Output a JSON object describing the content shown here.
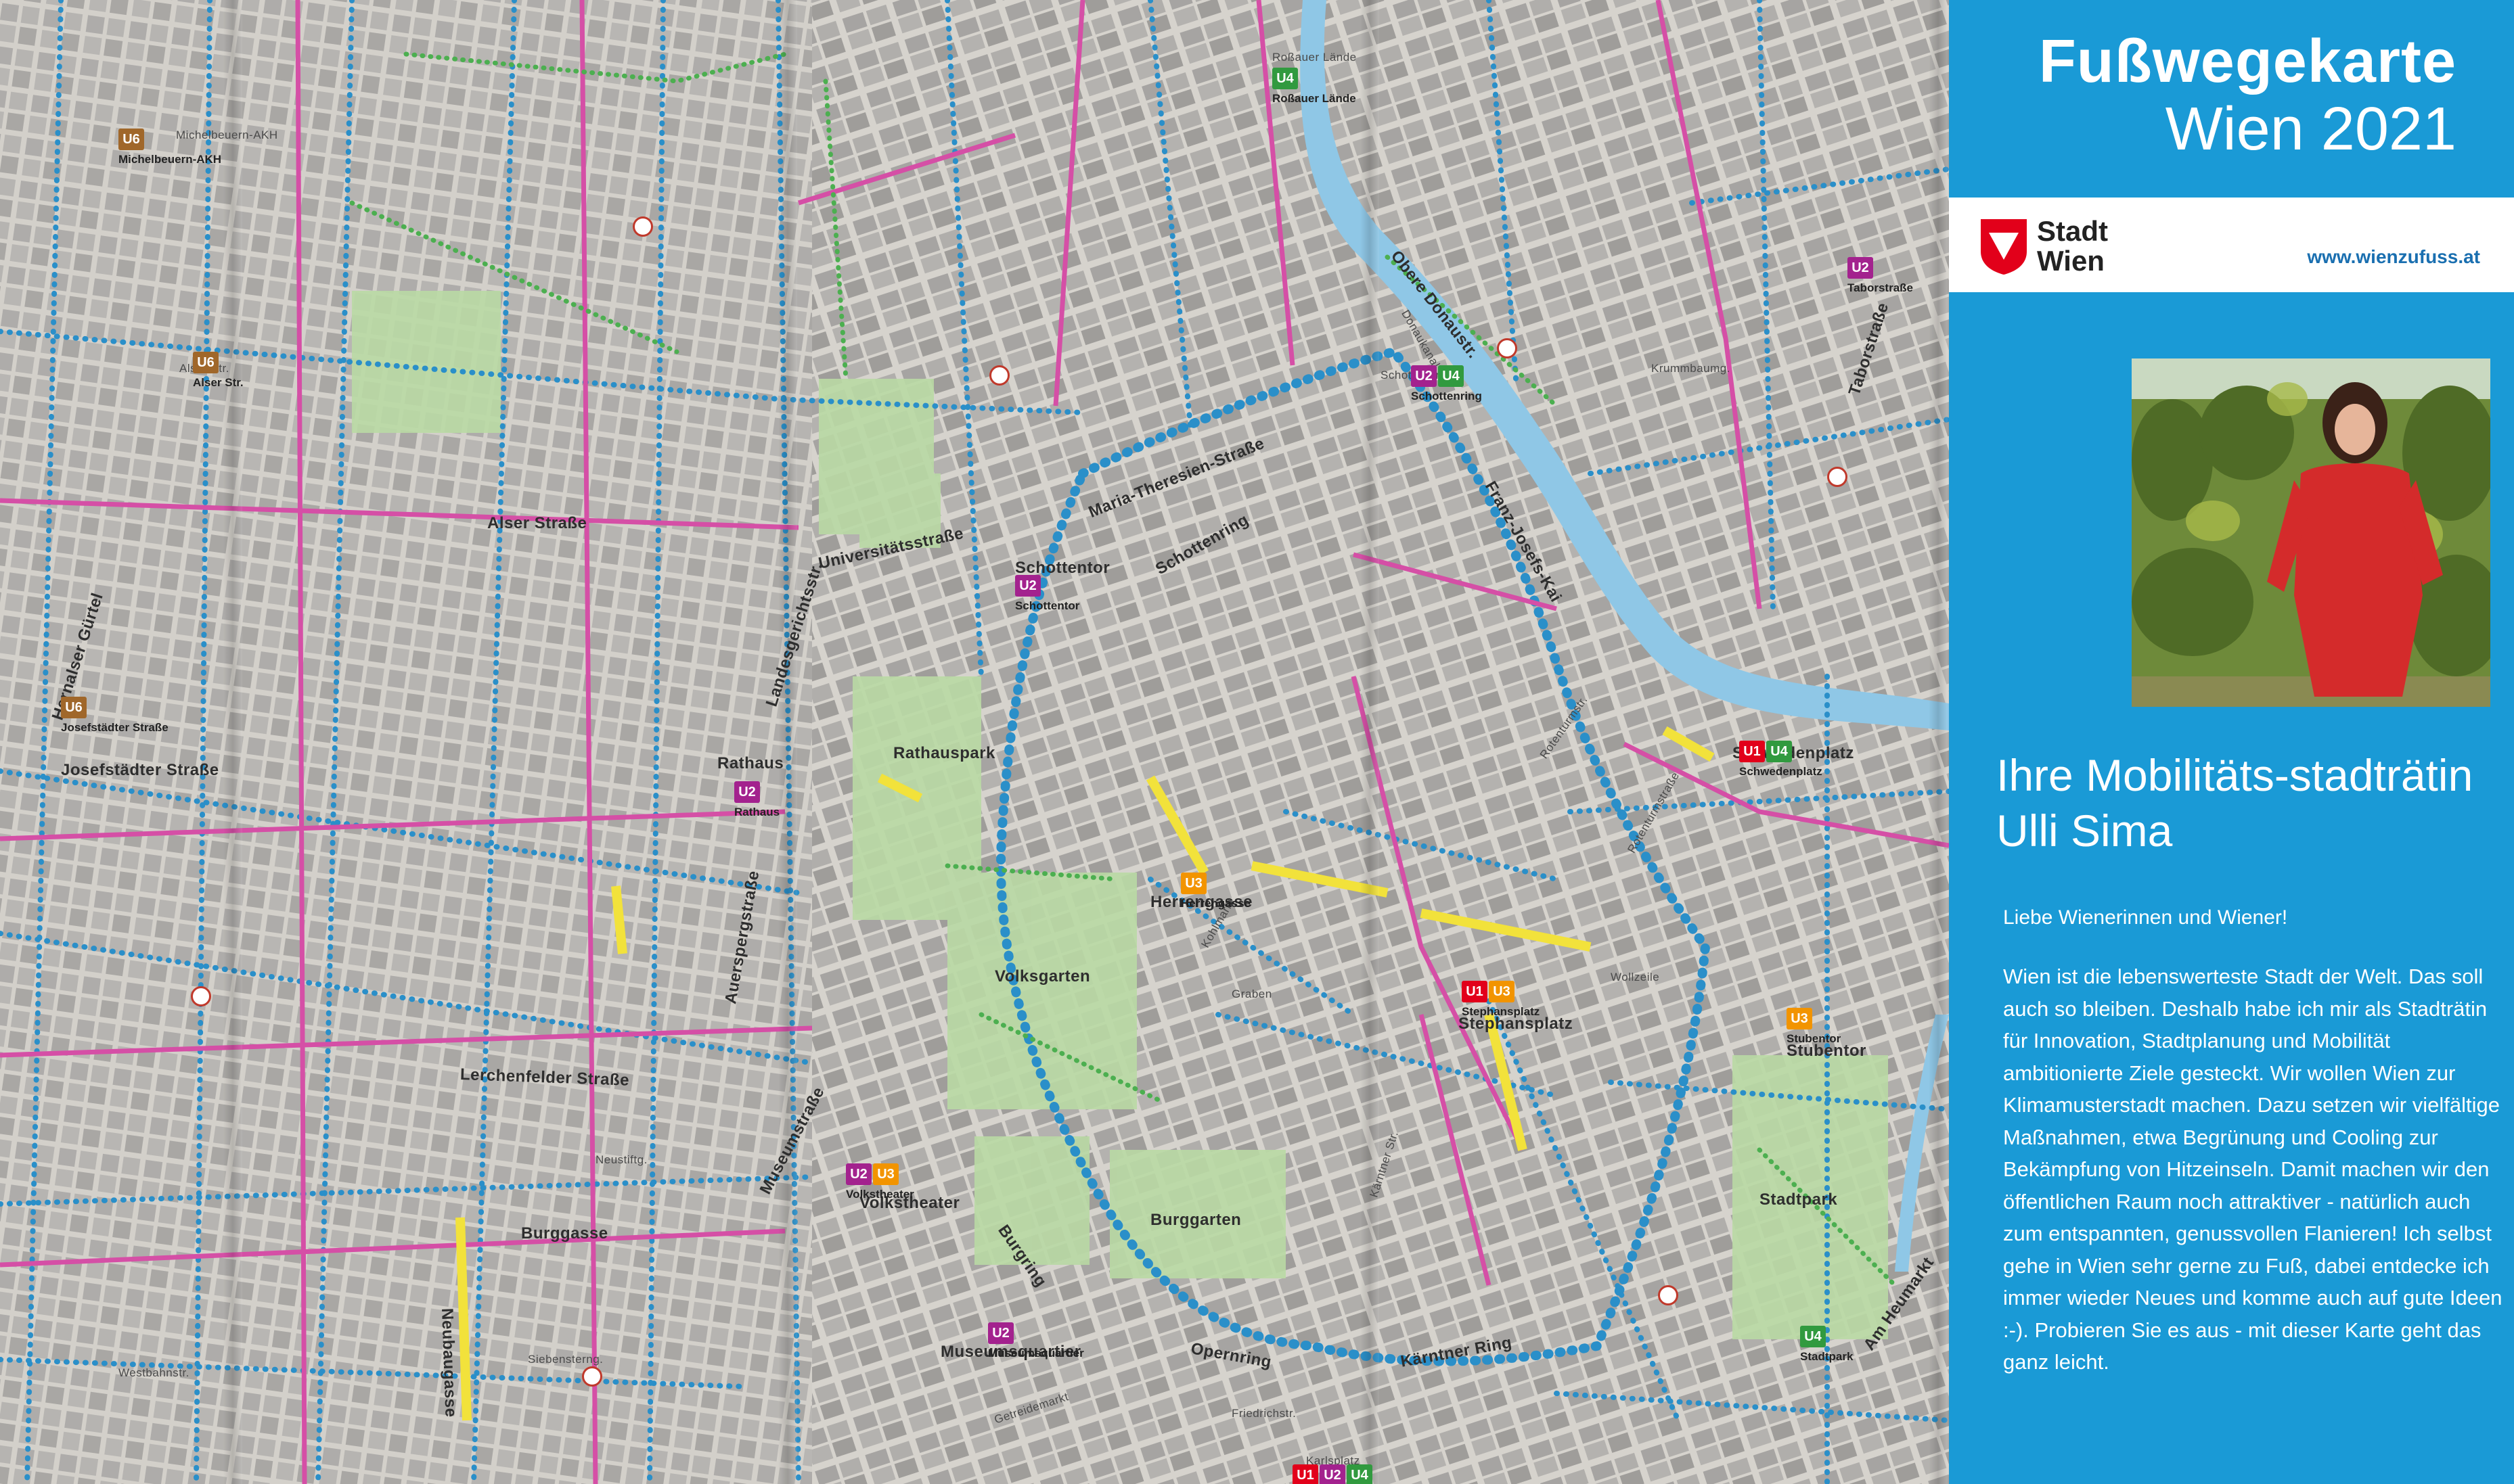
{
  "panel": {
    "title_line1": "Fußwegekarte",
    "title_line2": "Wien 2021",
    "logo_line1": "Stadt",
    "logo_line2": "Wien",
    "website": "www.wienzufuss.at",
    "heading": "Ihre Mobilitäts-stadträtin Ulli Sima",
    "greeting": "Liebe Wienerinnen und Wiener!",
    "body": "Wien ist die lebenswerteste Stadt der Welt. Das soll auch so bleiben. Deshalb habe ich mir als Stadträtin für Innovation, Stadtplanung und Mobilität ambitionierte Ziele gesteckt. Wir wollen Wien zur Klimamusterstadt machen. Dazu setzen wir vielfältige Maßnahmen, etwa Begrünung und Cooling zur Bekämpfung von Hitzeinseln. Damit machen wir den öffentlichen Raum noch attraktiver - natürlich auch zum entspannten, genussvollen Flanieren! Ich selbst gehe in Wien sehr gerne zu Fuß, dabei entdecke ich immer wieder Neues und komme auch auf gute Ideen :-). Probieren Sie es aus - mit dieser Karte geht das ganz leicht."
  },
  "colors": {
    "panel_blue": "#1a9ad6",
    "walk_blue": "#2a8fc9",
    "walk_pink": "#d54fa6",
    "walk_green": "#4caf50",
    "water": "#8fc7e6",
    "U1": "#e2001a",
    "U2": "#a3228e",
    "U3": "#f29400",
    "U4": "#319a3f",
    "U6": "#a0672a"
  },
  "map": {
    "streets": [
      {
        "text": "Universitätsstraße"
      },
      {
        "text": "Maria-Theresien-Straße"
      },
      {
        "text": "Hernalser Gürtel"
      },
      {
        "text": "Josefstädter Straße"
      },
      {
        "text": "Alser Straße"
      },
      {
        "text": "Lerchenfelder Straße"
      },
      {
        "text": "Burggasse"
      },
      {
        "text": "Neubaugasse"
      },
      {
        "text": "Museumstraße"
      },
      {
        "text": "Landesgerichtsstr."
      },
      {
        "text": "Auerspergstraße"
      },
      {
        "text": "Burgring"
      },
      {
        "text": "Opernring"
      },
      {
        "text": "Kärntner Ring"
      },
      {
        "text": "Schottenring"
      },
      {
        "text": "Franz-Josefs-Kai"
      },
      {
        "text": "Obere Donaustr."
      },
      {
        "text": "Taborstraße"
      },
      {
        "text": "Am Heumarkt"
      },
      {
        "text": "Herrengasse"
      },
      {
        "text": "Stephansplatz"
      },
      {
        "text": "Schwedenplatz"
      },
      {
        "text": "Stubentor"
      },
      {
        "text": "Stadtpark"
      },
      {
        "text": "Volksgarten"
      },
      {
        "text": "Burggarten"
      },
      {
        "text": "Rathauspark"
      },
      {
        "text": "Schottentor"
      },
      {
        "text": "Volkstheater"
      },
      {
        "text": "Museumsquartier"
      },
      {
        "text": "Rathaus"
      },
      {
        "text": "Alser Str."
      },
      {
        "text": "Michelbeuern-AKH"
      },
      {
        "text": "Roßauer Lände"
      },
      {
        "text": "Schottenring"
      },
      {
        "text": "Neustiftg."
      },
      {
        "text": "Westbahnstr."
      },
      {
        "text": "Siebensterng."
      },
      {
        "text": "Kärntner Str."
      },
      {
        "text": "Karlsplatz"
      },
      {
        "text": "Getreidemarkt"
      },
      {
        "text": "Friedrichstr."
      },
      {
        "text": "Donaukanal"
      },
      {
        "text": "Krummbaumg."
      },
      {
        "text": "Rotenturmstr."
      },
      {
        "text": "Wollzeile"
      },
      {
        "text": "Graben"
      },
      {
        "text": "Kohlmarkt"
      },
      {
        "text": "Rotenturmstraße"
      }
    ],
    "stations": [
      {
        "lines": [
          "U6"
        ],
        "name": "Michelbeuern-AKH"
      },
      {
        "lines": [
          "U6"
        ],
        "name": "Alser Str."
      },
      {
        "lines": [
          "U6"
        ],
        "name": "Josefstädter Straße"
      },
      {
        "lines": [
          "U2"
        ],
        "name": "Schottentor"
      },
      {
        "lines": [
          "U2"
        ],
        "name": "Rathaus"
      },
      {
        "lines": [
          "U2",
          "U3"
        ],
        "name": "Volkstheater"
      },
      {
        "lines": [
          "U2"
        ],
        "name": "Museumsquartier"
      },
      {
        "lines": [
          "U3"
        ],
        "name": "Herrengasse"
      },
      {
        "lines": [
          "U1",
          "U3"
        ],
        "name": "Stephansplatz"
      },
      {
        "lines": [
          "U1",
          "U4"
        ],
        "name": "Schwedenplatz"
      },
      {
        "lines": [
          "U2",
          "U4"
        ],
        "name": "Schottenring"
      },
      {
        "lines": [
          "U4"
        ],
        "name": "Roßauer Lände"
      },
      {
        "lines": [
          "U3"
        ],
        "name": "Stubentor"
      },
      {
        "lines": [
          "U4"
        ],
        "name": "Stadtpark"
      },
      {
        "lines": [
          "U2"
        ],
        "name": "Taborstraße"
      },
      {
        "lines": [
          "U1",
          "U2",
          "U4"
        ],
        "name": "Karlsplatz"
      }
    ]
  }
}
